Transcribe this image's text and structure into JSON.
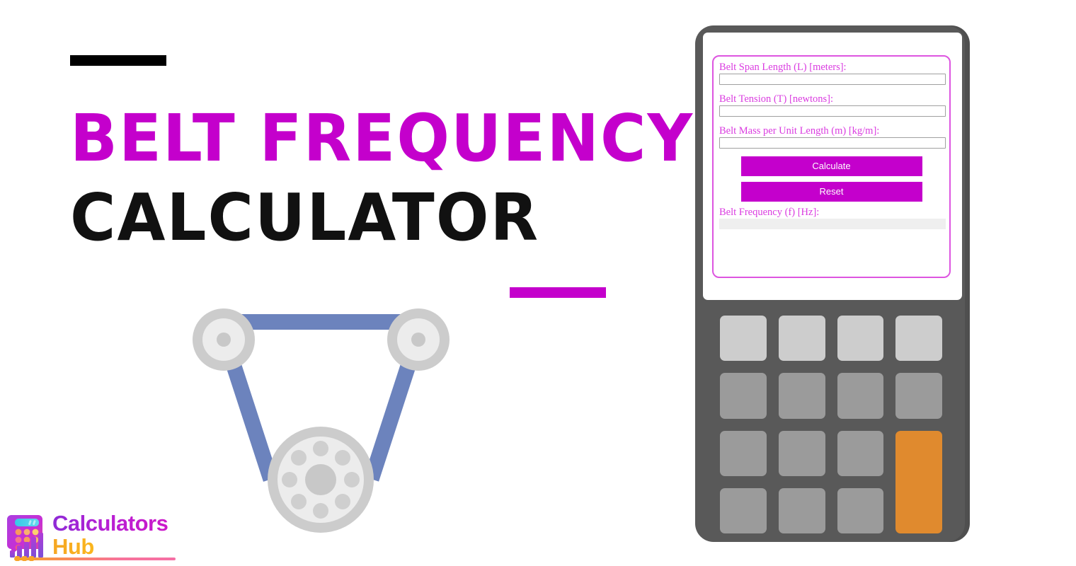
{
  "page": {
    "title_line_1": "Belt Frequency",
    "title_line_2": "Calculator",
    "accent_color": "#C400CC",
    "title_color_1": "#C400CC",
    "title_color_2": "#111111"
  },
  "illustration": {
    "name": "belt-pulley-system",
    "belt_color": "#6C83BD",
    "pulley_ring_color": "#CCCCCC",
    "pulley_face_color": "#ECECEC",
    "pulley_hub_color": "#C8C8C8",
    "large_pulley_hole_count": 8
  },
  "calculator": {
    "body_color": "#595959",
    "screen_color": "#FFFFFF",
    "form": {
      "border_color": "#DD55E0",
      "label_color": "#DA3BE0",
      "fields": [
        {
          "label": "Belt Span Length (L) [meters]:",
          "value": "",
          "placeholder": "",
          "name": "belt-span-length-input"
        },
        {
          "label": "Belt Tension (T) [newtons]:",
          "value": "",
          "placeholder": "",
          "name": "belt-tension-input"
        },
        {
          "label": "Belt Mass per Unit Length (m) [kg/m]:",
          "value": "",
          "placeholder": "",
          "name": "belt-mass-per-unit-length-input"
        }
      ],
      "buttons": {
        "calculate_label": "Calculate",
        "reset_label": "Reset",
        "color": "#C400CC",
        "text_color": "#FFFFFF"
      },
      "result": {
        "label": "Belt Frequency (f) [Hz]:",
        "value": "",
        "background": "#EFEFEF"
      }
    },
    "keypad": {
      "rows": 4,
      "columns": 4,
      "key_color": "#9B9B9B",
      "light_key_color": "#CDCDCD",
      "accent_key_color": "#E08A2E",
      "keys": [
        {
          "name": "keypad-key-r1c1",
          "style": "light"
        },
        {
          "name": "keypad-key-r1c2",
          "style": "light"
        },
        {
          "name": "keypad-key-r1c3",
          "style": "light"
        },
        {
          "name": "keypad-key-r1c4",
          "style": "light"
        },
        {
          "name": "keypad-key-r2c1",
          "style": "normal"
        },
        {
          "name": "keypad-key-r2c2",
          "style": "normal"
        },
        {
          "name": "keypad-key-r2c3",
          "style": "normal"
        },
        {
          "name": "keypad-key-r2c4",
          "style": "normal"
        },
        {
          "name": "keypad-key-r3c1",
          "style": "normal"
        },
        {
          "name": "keypad-key-r3c2",
          "style": "normal"
        },
        {
          "name": "keypad-key-r3c3",
          "style": "normal"
        },
        {
          "name": "keypad-key-equals",
          "style": "accent"
        },
        {
          "name": "keypad-key-r4c1",
          "style": "normal"
        },
        {
          "name": "keypad-key-r4c2",
          "style": "normal"
        },
        {
          "name": "keypad-key-r4c3",
          "style": "normal"
        }
      ]
    }
  },
  "logo": {
    "word_1": "Calculators",
    "word_2": "Hub",
    "mark_name": "calculator-bars-icon",
    "word_1_gradient": [
      "#8E2BD6",
      "#CE18C8"
    ],
    "word_2_gradient": [
      "#F5A623",
      "#FFD02E"
    ]
  }
}
